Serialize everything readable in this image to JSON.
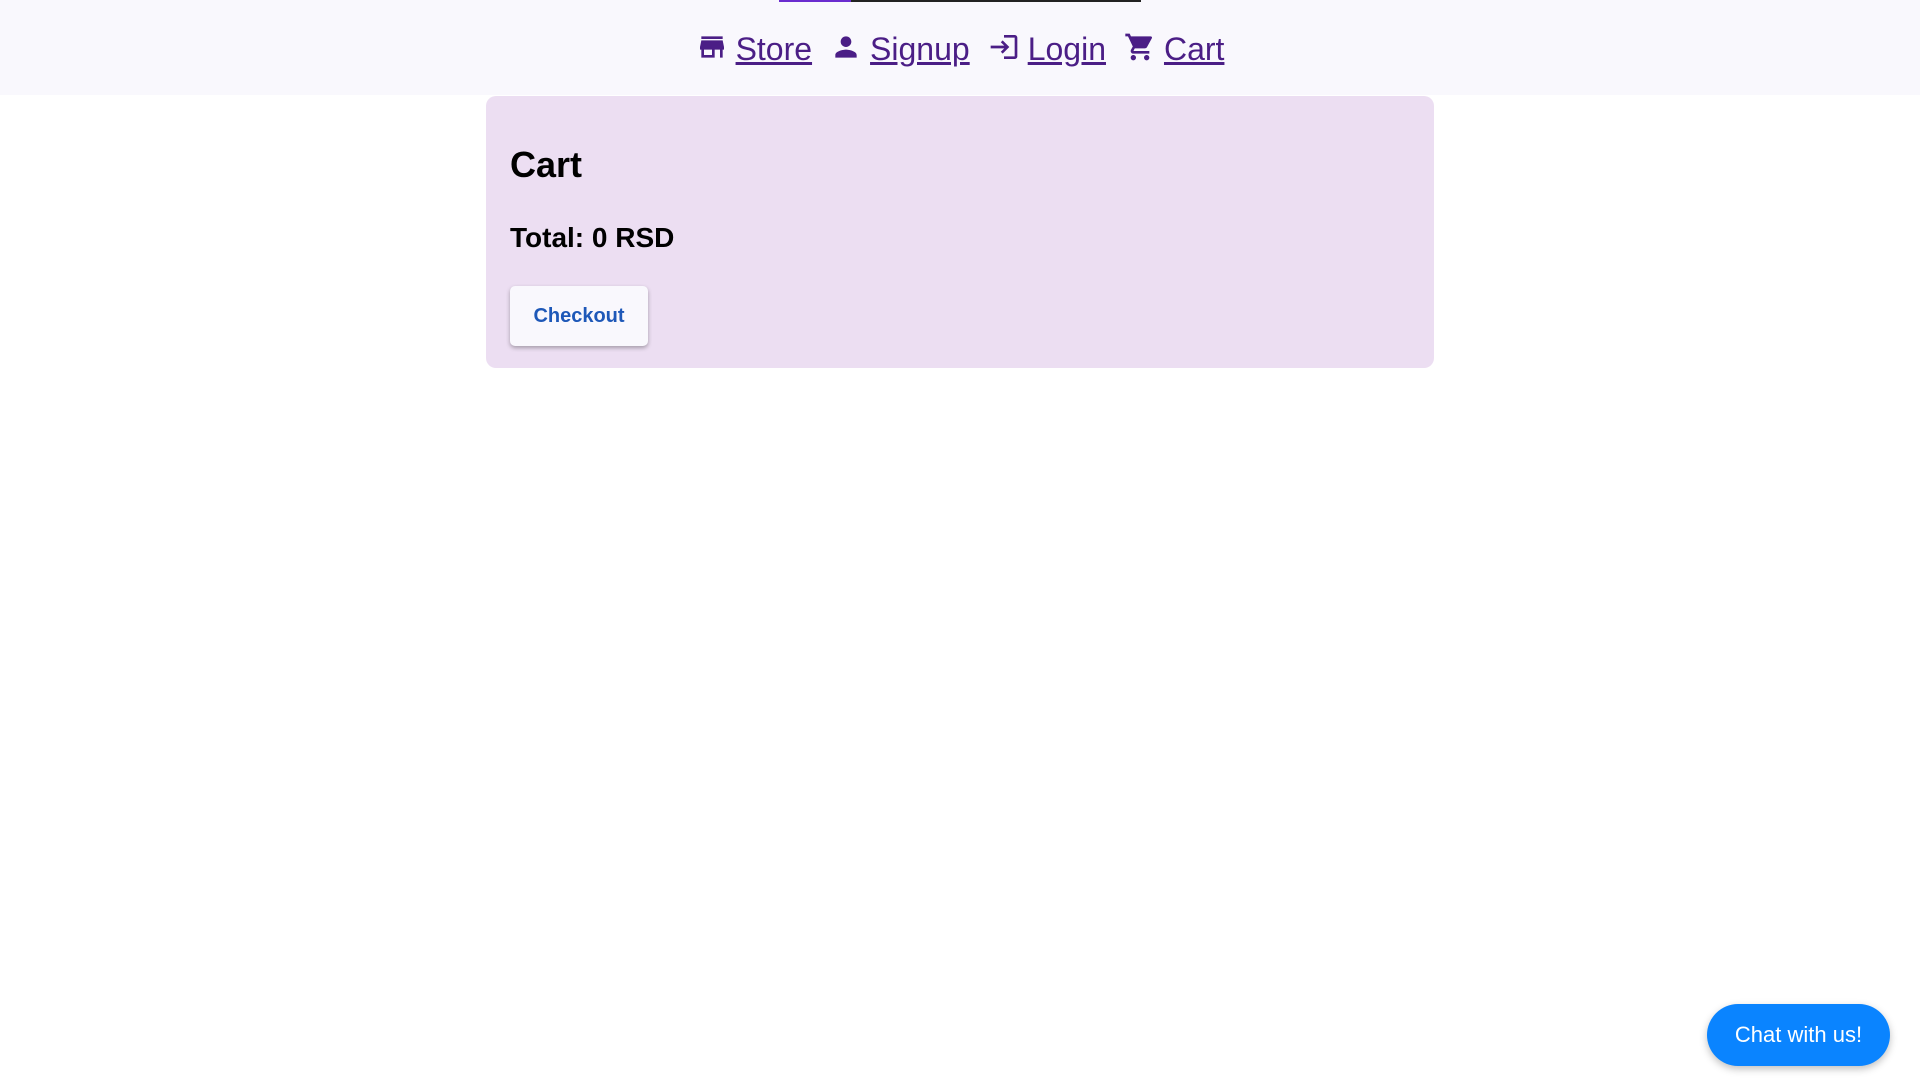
{
  "nav": {
    "items": [
      {
        "label": "Store",
        "icon": "store-icon"
      },
      {
        "label": "Signup",
        "icon": "person-icon"
      },
      {
        "label": "Login",
        "icon": "login-icon"
      },
      {
        "label": "Cart",
        "icon": "cart-icon"
      }
    ],
    "link_color": "#4b1e86",
    "background": "#f9f8fd"
  },
  "loading_bar": {
    "progress": 0.2,
    "fill_color": "#6a2ccf",
    "track_color": "#222222"
  },
  "cart": {
    "title": "Cart",
    "total": "Total: 0 RSD",
    "checkout_label": "Checkout",
    "background": "#ecdef2"
  },
  "chat": {
    "label": "Chat with us!",
    "color": "#0a84ff"
  }
}
